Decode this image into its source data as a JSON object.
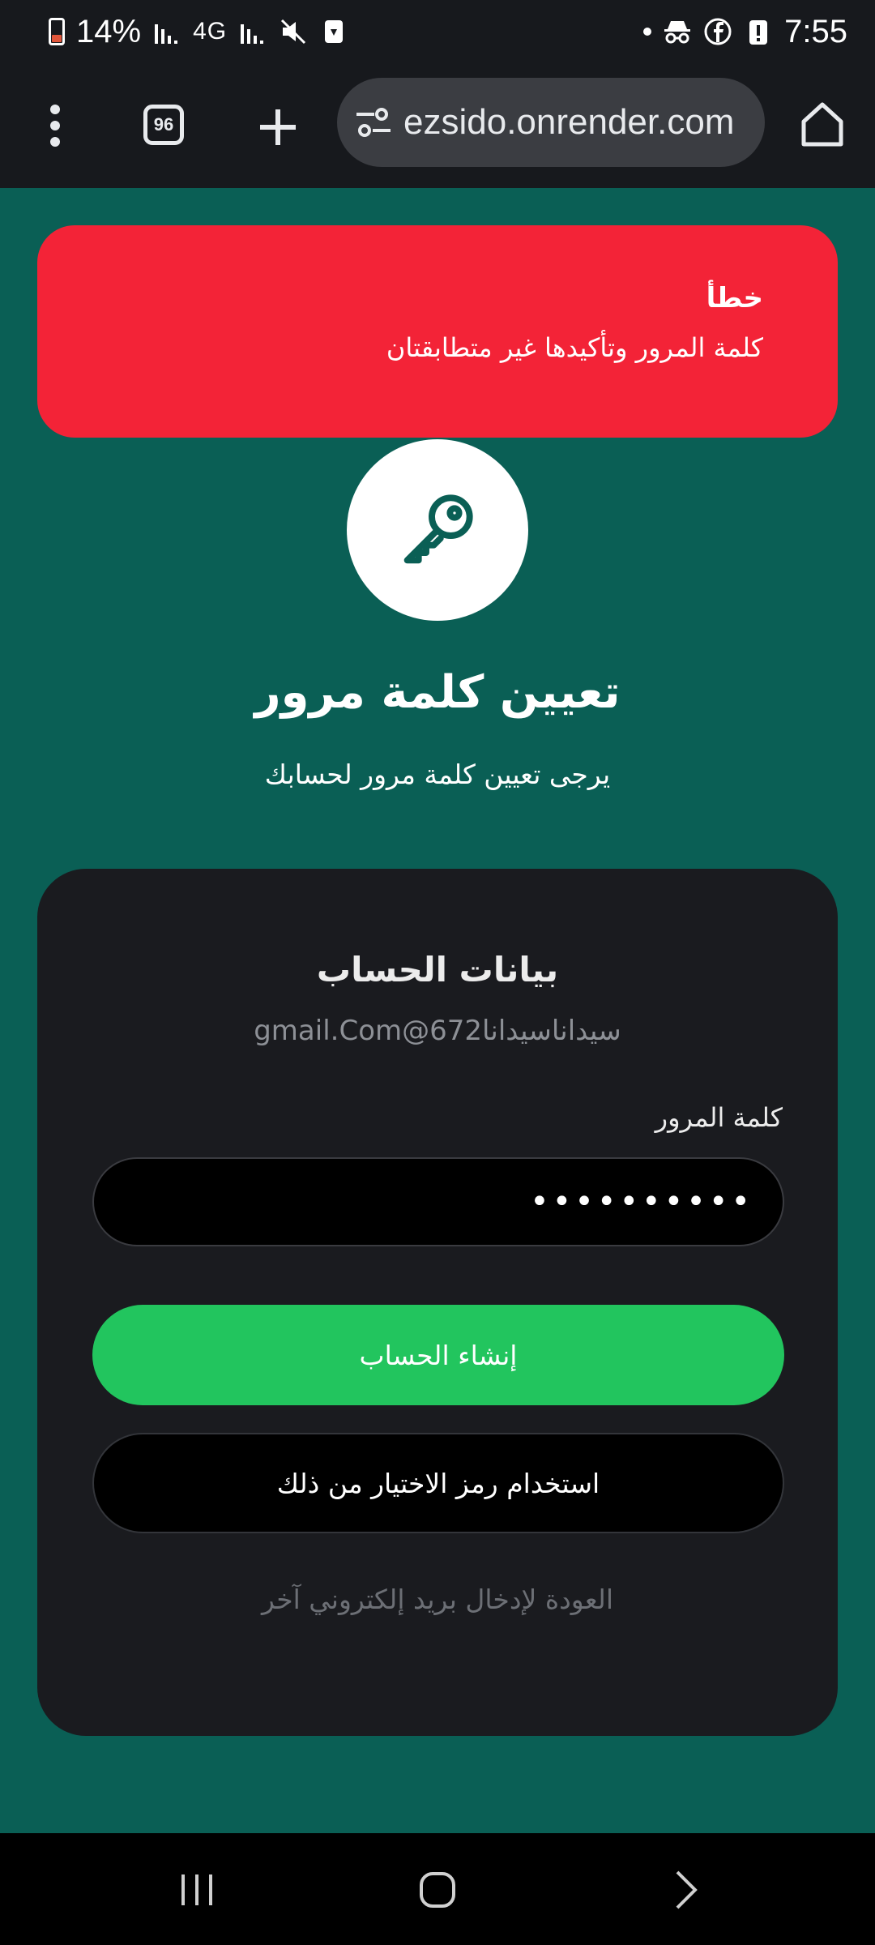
{
  "status_bar": {
    "battery": "14%",
    "network": "4G",
    "time": "7:55",
    "icons": [
      "battery-icon",
      "signal-icon",
      "4g-icon",
      "signal-icon",
      "mute-icon",
      "sim-icon",
      "dot-icon",
      "incognito-icon",
      "facebook-icon",
      "alert-icon"
    ]
  },
  "browser": {
    "tab_count": "96",
    "url": "ezsido.onrender.com",
    "icons": [
      "menu-icon",
      "tabs-icon",
      "plus-icon",
      "site-settings-icon",
      "home-icon"
    ]
  },
  "error": {
    "title": "خطأ",
    "message": "كلمة المرور وتأكيدها غير متطابقتان",
    "color": "#f32337"
  },
  "header": {
    "icon": "key-icon",
    "title": "تعيين كلمة مرور",
    "subtitle": "يرجى تعيين كلمة مرور لحسابك"
  },
  "card": {
    "title": "بيانات الحساب",
    "email": "سيداناسيدانا672@gmail.Com",
    "password_label": "كلمة المرور",
    "password_value": "••••••••••",
    "create_button": "إنشاء الحساب",
    "passkey_button": "استخدام رمز الاختيار من ذلك",
    "back_link": "العودة لإدخال بريد إلكتروني آخر"
  },
  "colors": {
    "page_bg": "#0a5f55",
    "card_bg": "#1a1b1f",
    "primary": "#22c55e"
  },
  "navbar": {
    "icons": [
      "recents-icon",
      "home-circle-icon",
      "back-icon"
    ]
  }
}
